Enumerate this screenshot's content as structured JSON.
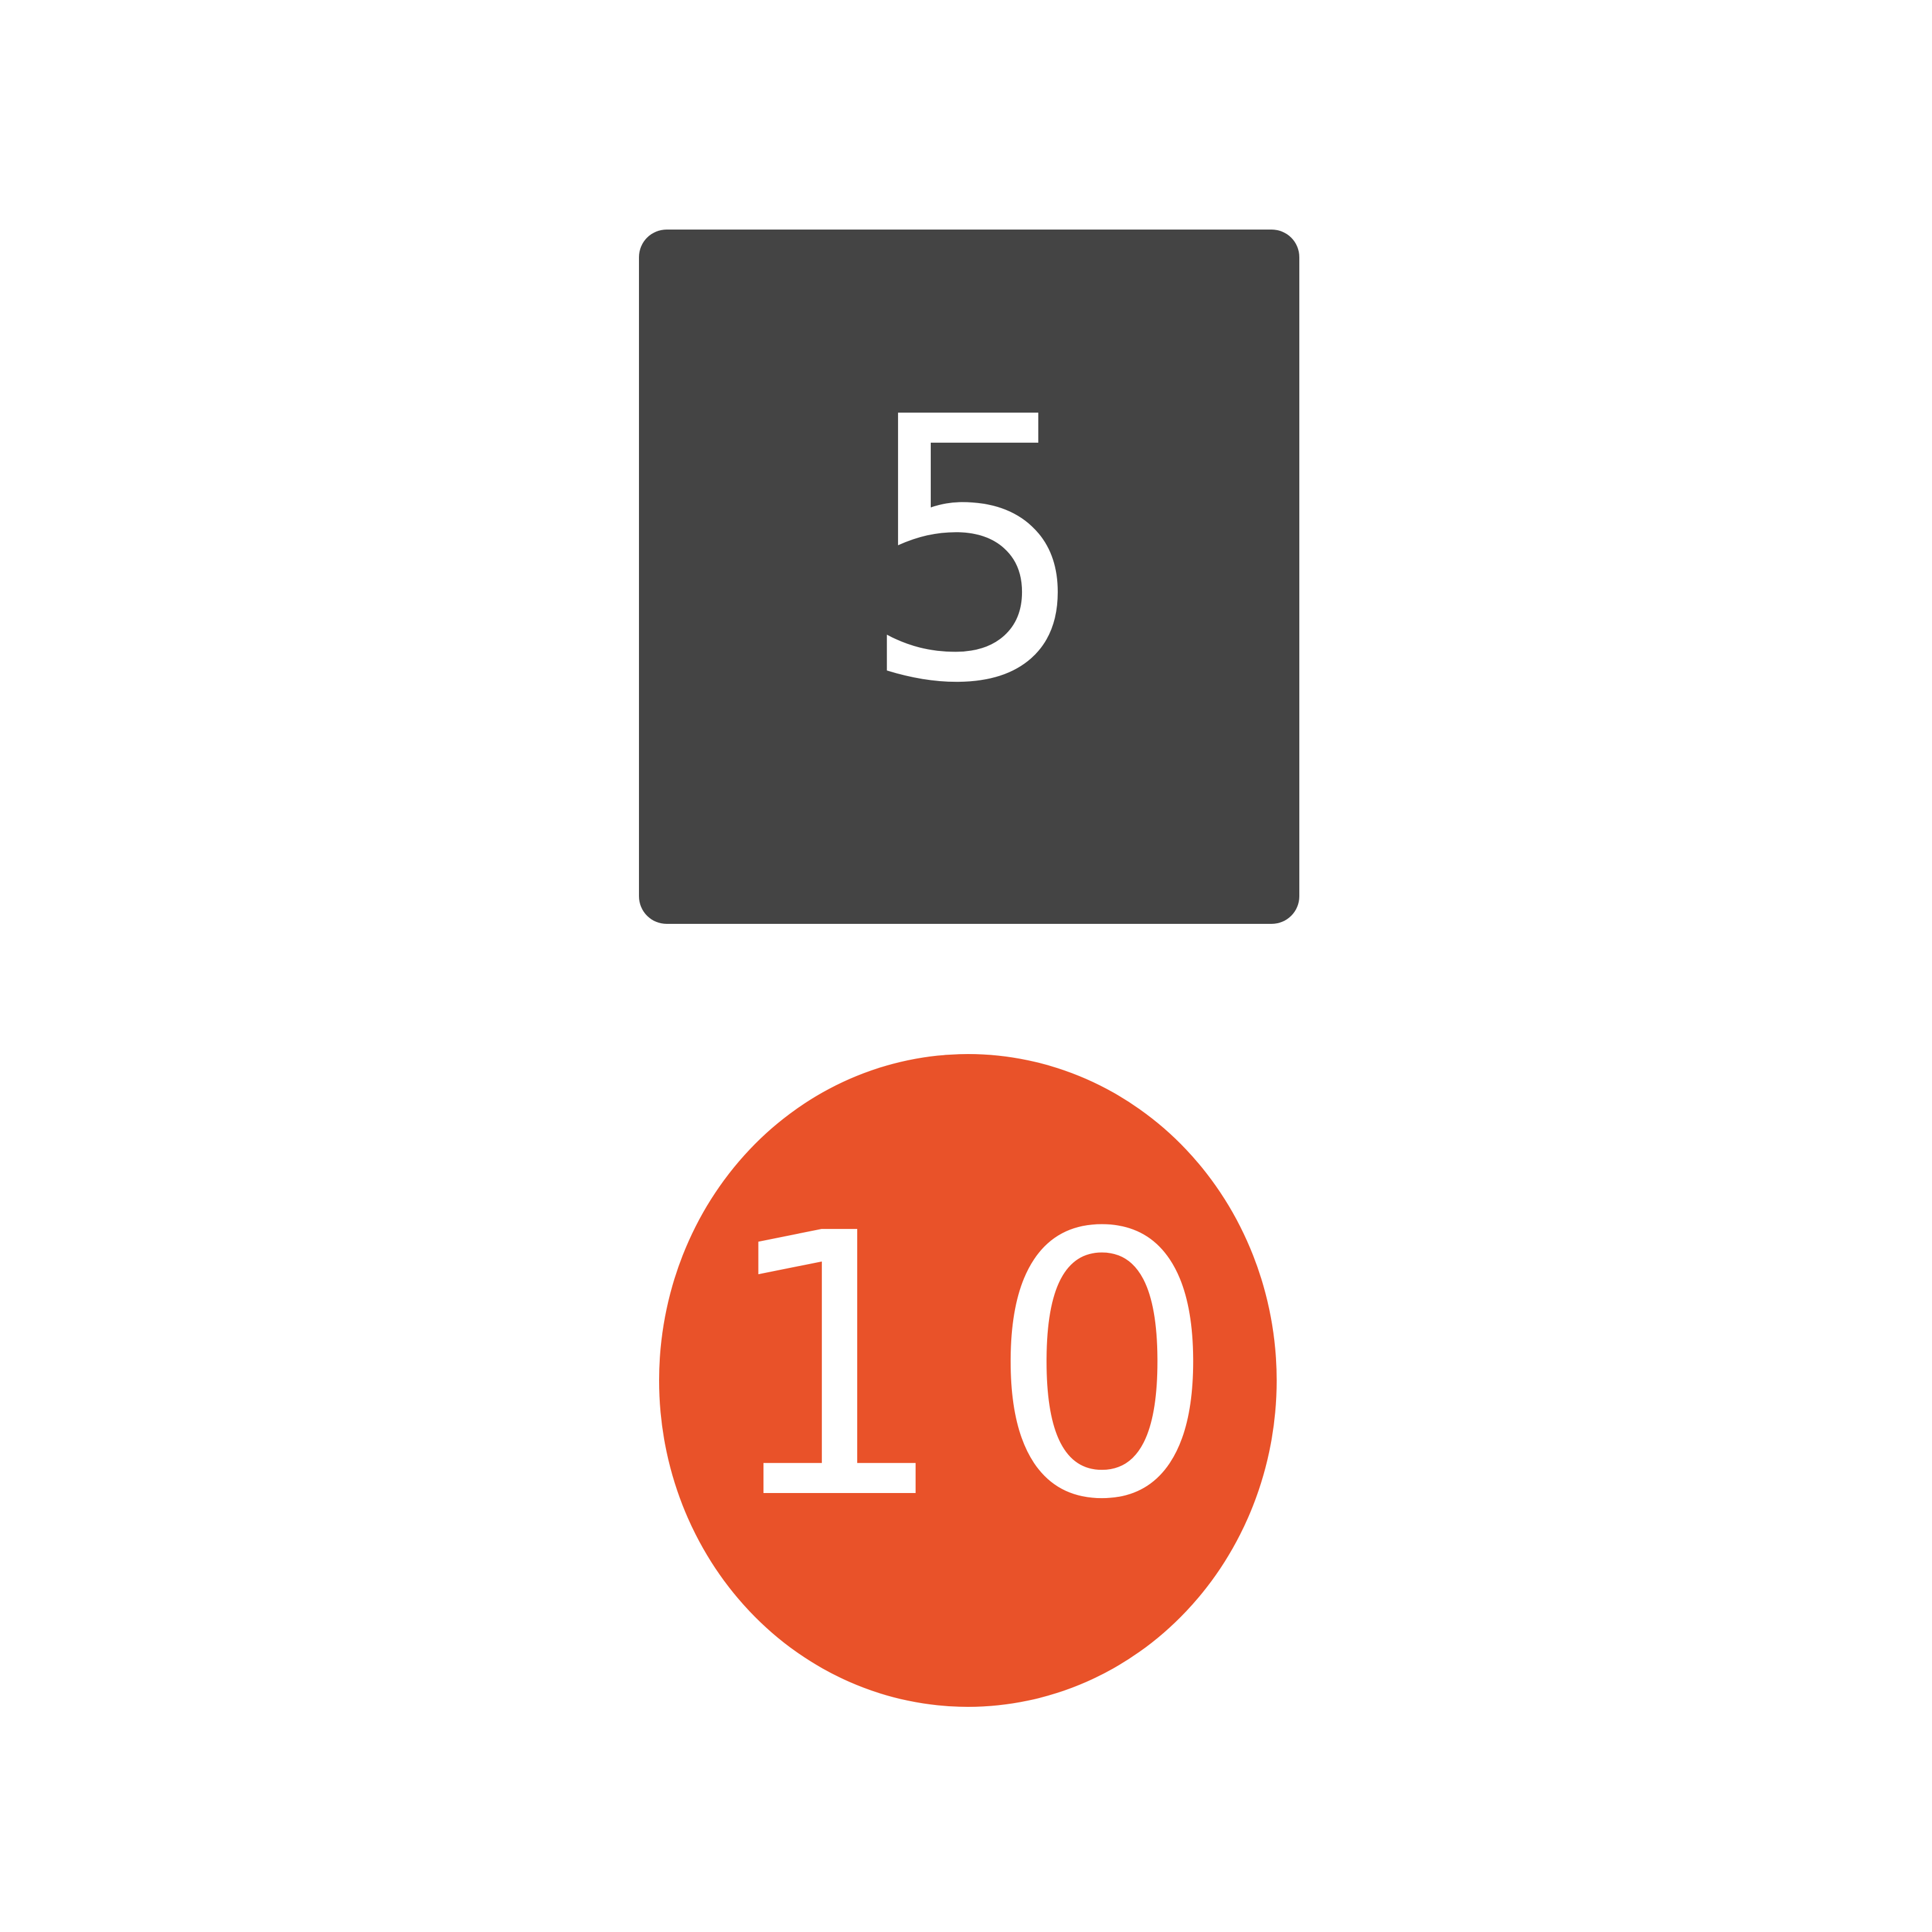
{
  "tiles": {
    "square": {
      "value": "5",
      "color": "#444444"
    },
    "circle": {
      "value": "10",
      "color": "#e95229"
    }
  },
  "text_color": "#ffffff"
}
